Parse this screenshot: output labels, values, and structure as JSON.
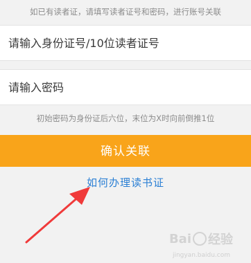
{
  "notice": "如已有读者证，请填写读者证号和密码，进行账号关联",
  "form": {
    "id_placeholder": "请输入身份证号/10位读者证号",
    "password_placeholder": "请输入密码",
    "hint": "初始密码为身份证后六位，末位为X时向前倒推1位"
  },
  "confirm_label": "确认关联",
  "apply_link": "如何办理读书证",
  "colors": {
    "background": "#f2f2f2",
    "confirm_button": "#f9a41a",
    "link": "#2a7fd4",
    "arrow": "#f03a3a"
  },
  "watermark": {
    "logo": "Bai",
    "logo_suffix": "经验",
    "sub": "jingyan.baidu.com"
  }
}
